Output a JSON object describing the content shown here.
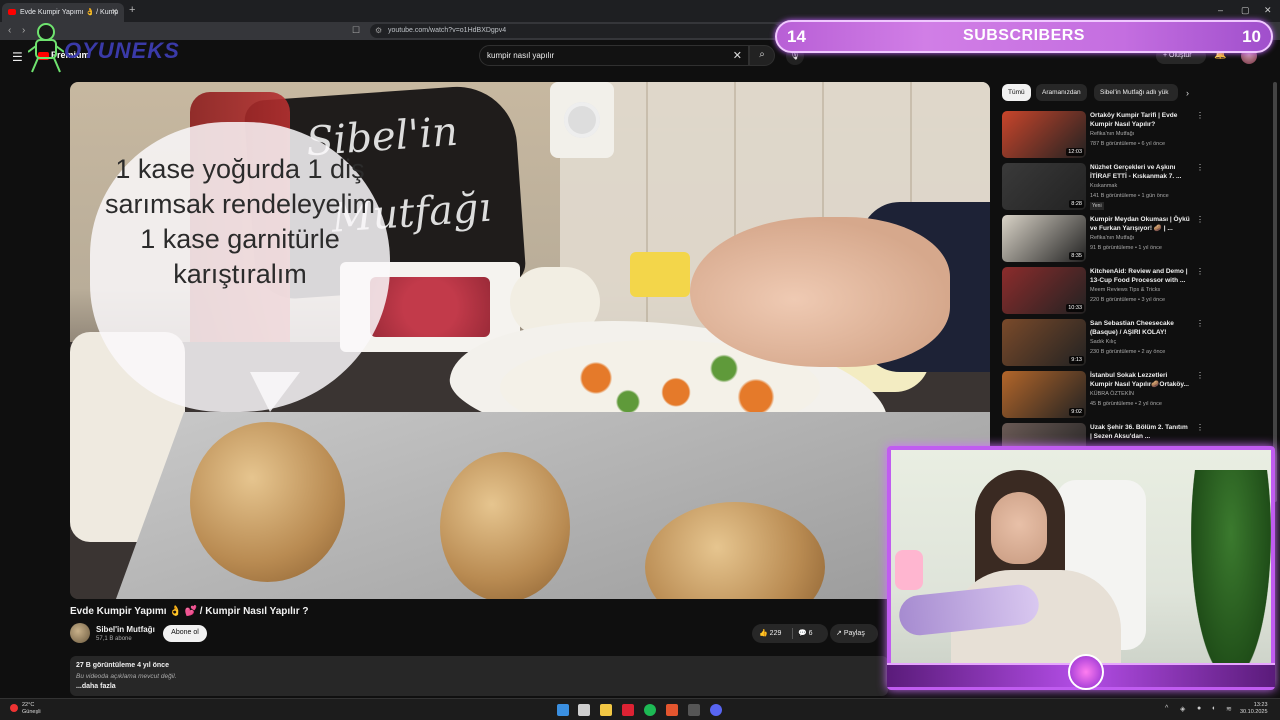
{
  "browser": {
    "tab_title": "Evde Kumpir Yapımı 👌 / Kump",
    "url": "youtube.com/watch?v=o1HdBXDgpv4"
  },
  "youtube": {
    "logo": "Premium",
    "search_query": "kumpir nasıl yapılır",
    "create_label": "Oluştur"
  },
  "overlay": {
    "brand": "OYUNEKS",
    "subs_left": "14",
    "subs_label": "SUBSCRIBERS",
    "subs_right": "10"
  },
  "video": {
    "caption": "1 kase yoğurda 1 diş sarımsak rendeleyelim 1 kase garnitürle karıştıralım",
    "board_line1": "Sibel'in",
    "board_line2": "Mutfağı",
    "title": "Evde Kumpir Yapımı 👌 💕 / Kumpir Nasıl Yapılır ?",
    "channel": "Sibel'in Mutfağı",
    "channel_subs": "57,1 B abone",
    "subscribe": "Abone ol",
    "likes": "229",
    "comments": "6",
    "share": "Paylaş",
    "views": "27 B görüntüleme  4 yıl önce",
    "no_desc": "Bu videoda açıklama mevcut değil.",
    "more": "...daha fazla"
  },
  "sidebar": {
    "chips": [
      {
        "label": "Tümü"
      },
      {
        "label": "Aramanızdan"
      },
      {
        "label": "Sibel'in Mutfağı adlı yük"
      }
    ],
    "recs": [
      {
        "title": "Ortaköy Kumpir Tarifi | Evde Kumpir Nasıl Yapılır?",
        "channel": "Refika'nın Mutfağı",
        "meta": "787 B görüntüleme • 6 yıl önce",
        "duration": "12:03",
        "badge": "",
        "color": "#c9452b"
      },
      {
        "title": "Nüzhet Gerçekleri ve Aşkını İTİRAF ETTİ - Kıskanmak 7. ...",
        "channel": "Kıskanmak",
        "meta": "141 B görüntüleme • 1 gün önce",
        "duration": "8:28",
        "badge": "Yeni",
        "color": "#3a3a3a"
      },
      {
        "title": "Kumpir Meydan Okuması | Öykü ve Furkan Yarışıyor! 🥔 | ...",
        "channel": "Refika'nın Mutfağı",
        "meta": "91 B görüntüleme • 1 yıl önce",
        "duration": "8:35",
        "badge": "",
        "color": "#d9d3c7"
      },
      {
        "title": "KitchenAid: Review and Demo | 13-Cup Food Processor with ...",
        "channel": "Meem Reviews Tips & Tricks",
        "meta": "220 B görüntüleme • 3 yıl önce",
        "duration": "10:33",
        "badge": "",
        "color": "#8c2c2c"
      },
      {
        "title": "San Sebastian Cheesecake (Basque) / AŞIRI KOLAY!",
        "channel": "Sadık Kılıç",
        "meta": "230 B görüntüleme • 2 ay önce",
        "duration": "9:13",
        "badge": "",
        "color": "#7a4a2a"
      },
      {
        "title": "İstanbul Sokak Lezzetleri Kumpir Nasıl Yapılır🥔Ortaköy...",
        "channel": "KÜBRA ÖZTEKİN",
        "meta": "45 B görüntüleme • 2 yıl önce",
        "duration": "9:02",
        "badge": "",
        "color": "#b3662a"
      },
      {
        "title": "Uzak Şehir 36. Bölüm 2. Tanıtım | Sezen Aksu'dan ...",
        "channel": "",
        "meta": "",
        "duration": "",
        "badge": "",
        "color": "#6a5a55"
      }
    ]
  },
  "taskbar": {
    "temp": "22°C",
    "weather": "Güneşli",
    "time": "13:23",
    "date": "30.10.2025"
  }
}
